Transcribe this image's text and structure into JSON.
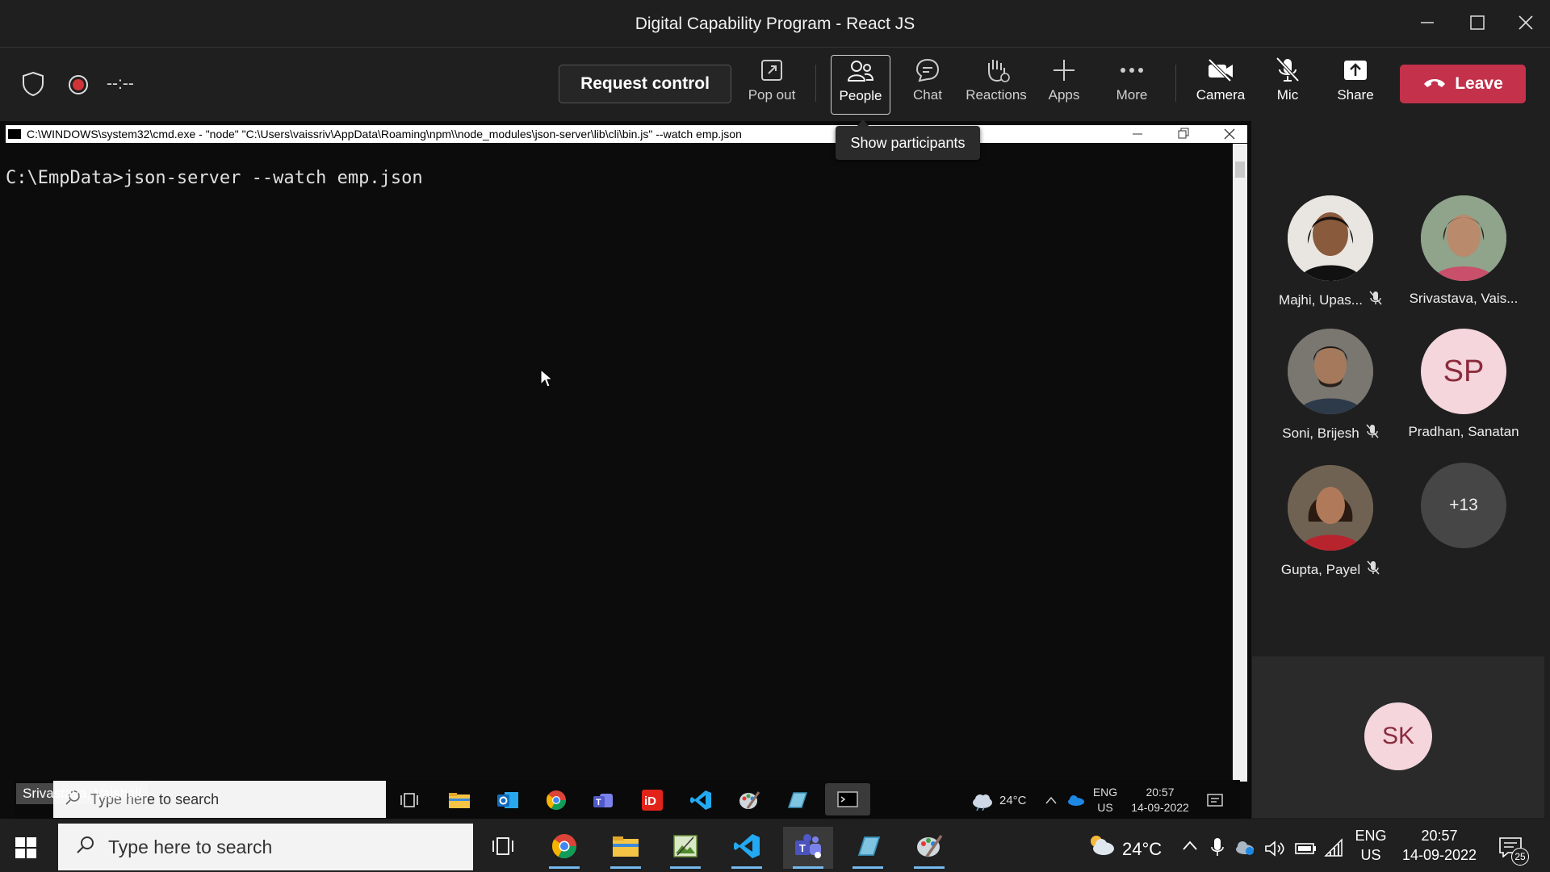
{
  "window": {
    "title": "Digital Capability Program - React JS"
  },
  "toolbar": {
    "timer": "--:--",
    "request_control": "Request control",
    "popout": "Pop out",
    "people": "People",
    "chat": "Chat",
    "reactions": "Reactions",
    "apps": "Apps",
    "more": "More",
    "camera": "Camera",
    "mic": "Mic",
    "share": "Share",
    "leave": "Leave",
    "tooltip": "Show participants"
  },
  "shared_screen": {
    "cmd_title": "C:\\WINDOWS\\system32\\cmd.exe - \"node\"   \"C:\\Users\\vaissriv\\AppData\\Roaming\\npm\\\\node_modules\\json-server\\lib\\cli\\bin.js\" --watch emp.json",
    "command_line": "C:\\EmpData>json-server --watch emp.json",
    "presenter_name": "Srivastava, Vaishali",
    "search_placeholder": "Type here to search",
    "temperature": "24°C",
    "lang_top": "ENG",
    "lang_bottom": "US",
    "time": "20:57",
    "date": "14-09-2022"
  },
  "participants": [
    {
      "name": "Majhi, Upas...",
      "muted": true
    },
    {
      "name": "Srivastava, Vais...",
      "muted": false
    },
    {
      "name": "Soni, Brijesh",
      "muted": true
    },
    {
      "name": "Pradhan, Sanatan",
      "initials": "SP",
      "muted": false
    },
    {
      "name": "Gupta, Payel",
      "muted": true
    },
    {
      "overflow": "+13"
    }
  ],
  "self": {
    "initials": "SK"
  },
  "taskbar": {
    "search_placeholder": "Type here to search",
    "temperature": "24°C",
    "lang_top": "ENG",
    "lang_bottom": "US",
    "time": "20:57",
    "date": "14-09-2022",
    "notifications": "25"
  },
  "colors": {
    "leave": "#c4314b",
    "accent": "#76b9ed"
  }
}
